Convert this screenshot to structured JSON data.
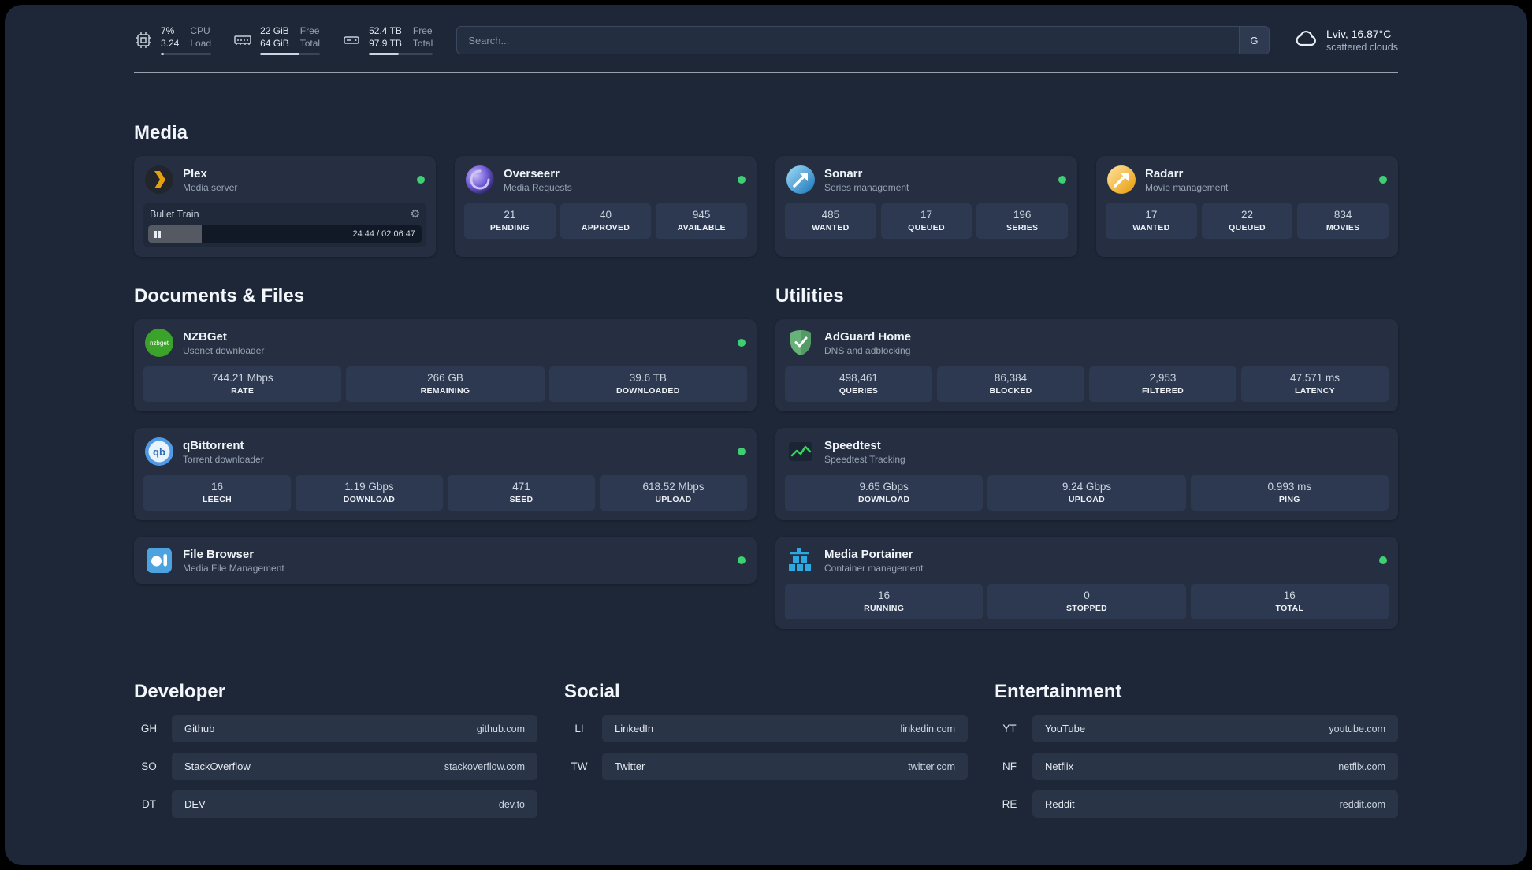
{
  "colors": {
    "status_online": "#3ecf72",
    "accent_bar": "#ccd4e0"
  },
  "icons": {
    "gear-icon": "⚙",
    "pause-icon": "double-bar",
    "cpu-icon": "chip-outline",
    "ram-icon": "memory-stick-outline",
    "disk-icon": "hard-drive-outline",
    "cloud-icon": "cloud-outline"
  },
  "header": {
    "cpu": {
      "value_top": "7%",
      "value_bottom": "3.24",
      "label_top": "CPU",
      "label_bottom": "Load",
      "bar_percent": 7
    },
    "ram": {
      "value_top": "22 GiB",
      "value_bottom": "64 GiB",
      "label_top": "Free",
      "label_bottom": "Total",
      "bar_percent": 66
    },
    "disk": {
      "value_top": "52.4 TB",
      "value_bottom": "97.9 TB",
      "label_top": "Free",
      "label_bottom": "Total",
      "bar_percent": 47
    },
    "search": {
      "placeholder": "Search...",
      "engine_label": "G"
    },
    "weather": {
      "location": "Lviv, 16.87°C",
      "condition": "scattered clouds"
    }
  },
  "sections": {
    "media": {
      "title": "Media",
      "cards": [
        {
          "name": "Plex",
          "subtitle": "Media server",
          "player": {
            "track": "Bullet Train",
            "time": "24:44 / 02:06:47",
            "progress_percent": 19.5
          }
        },
        {
          "name": "Overseerr",
          "subtitle": "Media Requests",
          "stats": [
            {
              "value": "21",
              "label": "PENDING"
            },
            {
              "value": "40",
              "label": "APPROVED"
            },
            {
              "value": "945",
              "label": "AVAILABLE"
            }
          ]
        },
        {
          "name": "Sonarr",
          "subtitle": "Series management",
          "stats": [
            {
              "value": "485",
              "label": "WANTED"
            },
            {
              "value": "17",
              "label": "QUEUED"
            },
            {
              "value": "196",
              "label": "SERIES"
            }
          ]
        },
        {
          "name": "Radarr",
          "subtitle": "Movie management",
          "stats": [
            {
              "value": "17",
              "label": "WANTED"
            },
            {
              "value": "22",
              "label": "QUEUED"
            },
            {
              "value": "834",
              "label": "MOVIES"
            }
          ]
        }
      ]
    },
    "documents": {
      "title": "Documents & Files",
      "cards": [
        {
          "name": "NZBGet",
          "subtitle": "Usenet downloader",
          "stats": [
            {
              "value": "744.21 Mbps",
              "label": "RATE"
            },
            {
              "value": "266 GB",
              "label": "REMAINING"
            },
            {
              "value": "39.6 TB",
              "label": "DOWNLOADED"
            }
          ]
        },
        {
          "name": "qBittorrent",
          "subtitle": "Torrent downloader",
          "stats": [
            {
              "value": "16",
              "label": "LEECH"
            },
            {
              "value": "1.19 Gbps",
              "label": "DOWNLOAD"
            },
            {
              "value": "471",
              "label": "SEED"
            },
            {
              "value": "618.52 Mbps",
              "label": "UPLOAD"
            }
          ]
        },
        {
          "name": "File Browser",
          "subtitle": "Media File Management",
          "stats": []
        }
      ]
    },
    "utilities": {
      "title": "Utilities",
      "cards": [
        {
          "name": "AdGuard Home",
          "subtitle": "DNS and adblocking",
          "stats": [
            {
              "value": "498,461",
              "label": "QUERIES"
            },
            {
              "value": "86,384",
              "label": "BLOCKED"
            },
            {
              "value": "2,953",
              "label": "FILTERED"
            },
            {
              "value": "47.571 ms",
              "label": "LATENCY"
            }
          ]
        },
        {
          "name": "Speedtest",
          "subtitle": "Speedtest Tracking",
          "stats": [
            {
              "value": "9.65 Gbps",
              "label": "DOWNLOAD"
            },
            {
              "value": "9.24 Gbps",
              "label": "UPLOAD"
            },
            {
              "value": "0.993 ms",
              "label": "PING"
            }
          ]
        },
        {
          "name": "Media Portainer",
          "subtitle": "Container management",
          "stats": [
            {
              "value": "16",
              "label": "RUNNING"
            },
            {
              "value": "0",
              "label": "STOPPED"
            },
            {
              "value": "16",
              "label": "TOTAL"
            }
          ]
        }
      ]
    },
    "bookmarks": [
      {
        "title": "Developer",
        "links": [
          {
            "abbr": "GH",
            "name": "Github",
            "domain": "github.com"
          },
          {
            "abbr": "SO",
            "name": "StackOverflow",
            "domain": "stackoverflow.com"
          },
          {
            "abbr": "DT",
            "name": "DEV",
            "domain": "dev.to"
          }
        ]
      },
      {
        "title": "Social",
        "links": [
          {
            "abbr": "LI",
            "name": "LinkedIn",
            "domain": "linkedin.com"
          },
          {
            "abbr": "TW",
            "name": "Twitter",
            "domain": "twitter.com"
          }
        ]
      },
      {
        "title": "Entertainment",
        "links": [
          {
            "abbr": "YT",
            "name": "YouTube",
            "domain": "youtube.com"
          },
          {
            "abbr": "NF",
            "name": "Netflix",
            "domain": "netflix.com"
          },
          {
            "abbr": "RE",
            "name": "Reddit",
            "domain": "reddit.com"
          }
        ]
      }
    ]
  }
}
